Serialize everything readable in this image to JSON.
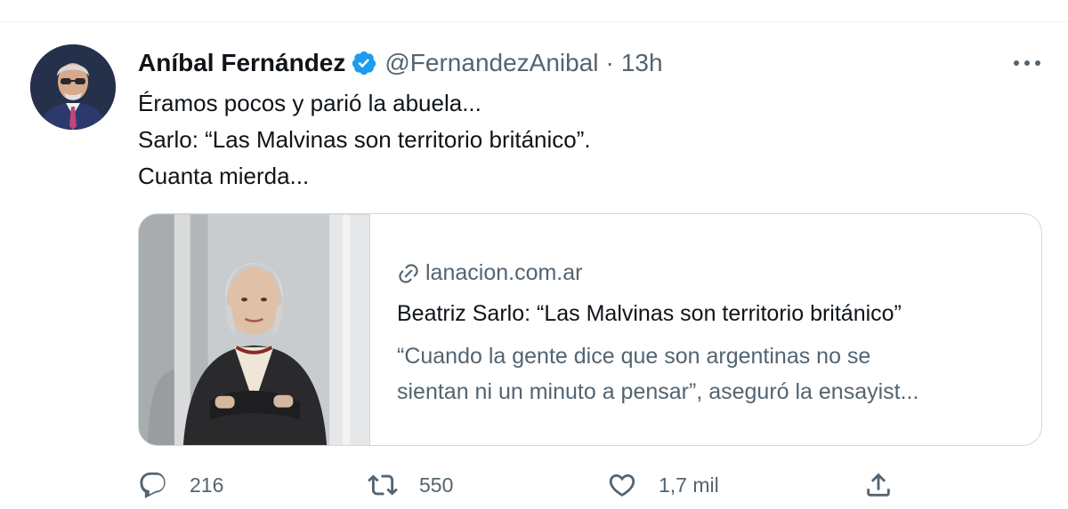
{
  "tweet": {
    "author_name": "Aníbal Fernández",
    "handle": "@FernandezAnibal",
    "separator": "·",
    "time": "13h",
    "lines": [
      "Éramos pocos y parió la abuela...",
      "Sarlo: “Las Malvinas son territorio británico”.",
      "Cuanta mierda..."
    ]
  },
  "icons": {
    "verified": "verified-badge-icon",
    "more": "more-options-icon",
    "link": "link-icon",
    "reply": "reply-icon",
    "retweet": "retweet-icon",
    "like": "like-icon",
    "share": "share-icon"
  },
  "card": {
    "domain": "lanacion.com.ar",
    "title": "Beatriz Sarlo: “Las Malvinas son territorio británico”",
    "description_lines": [
      "“Cuando la gente dice que son argentinas no se",
      "sientan ni un minuto a pensar”, aseguró la ensayist..."
    ]
  },
  "stats": {
    "replies": "216",
    "retweets": "550",
    "likes": "1,7 mil"
  },
  "colors": {
    "text_primary": "#0f1419",
    "text_secondary": "#536471",
    "verified_blue": "#1d9bf0",
    "border": "#cfd9de"
  }
}
